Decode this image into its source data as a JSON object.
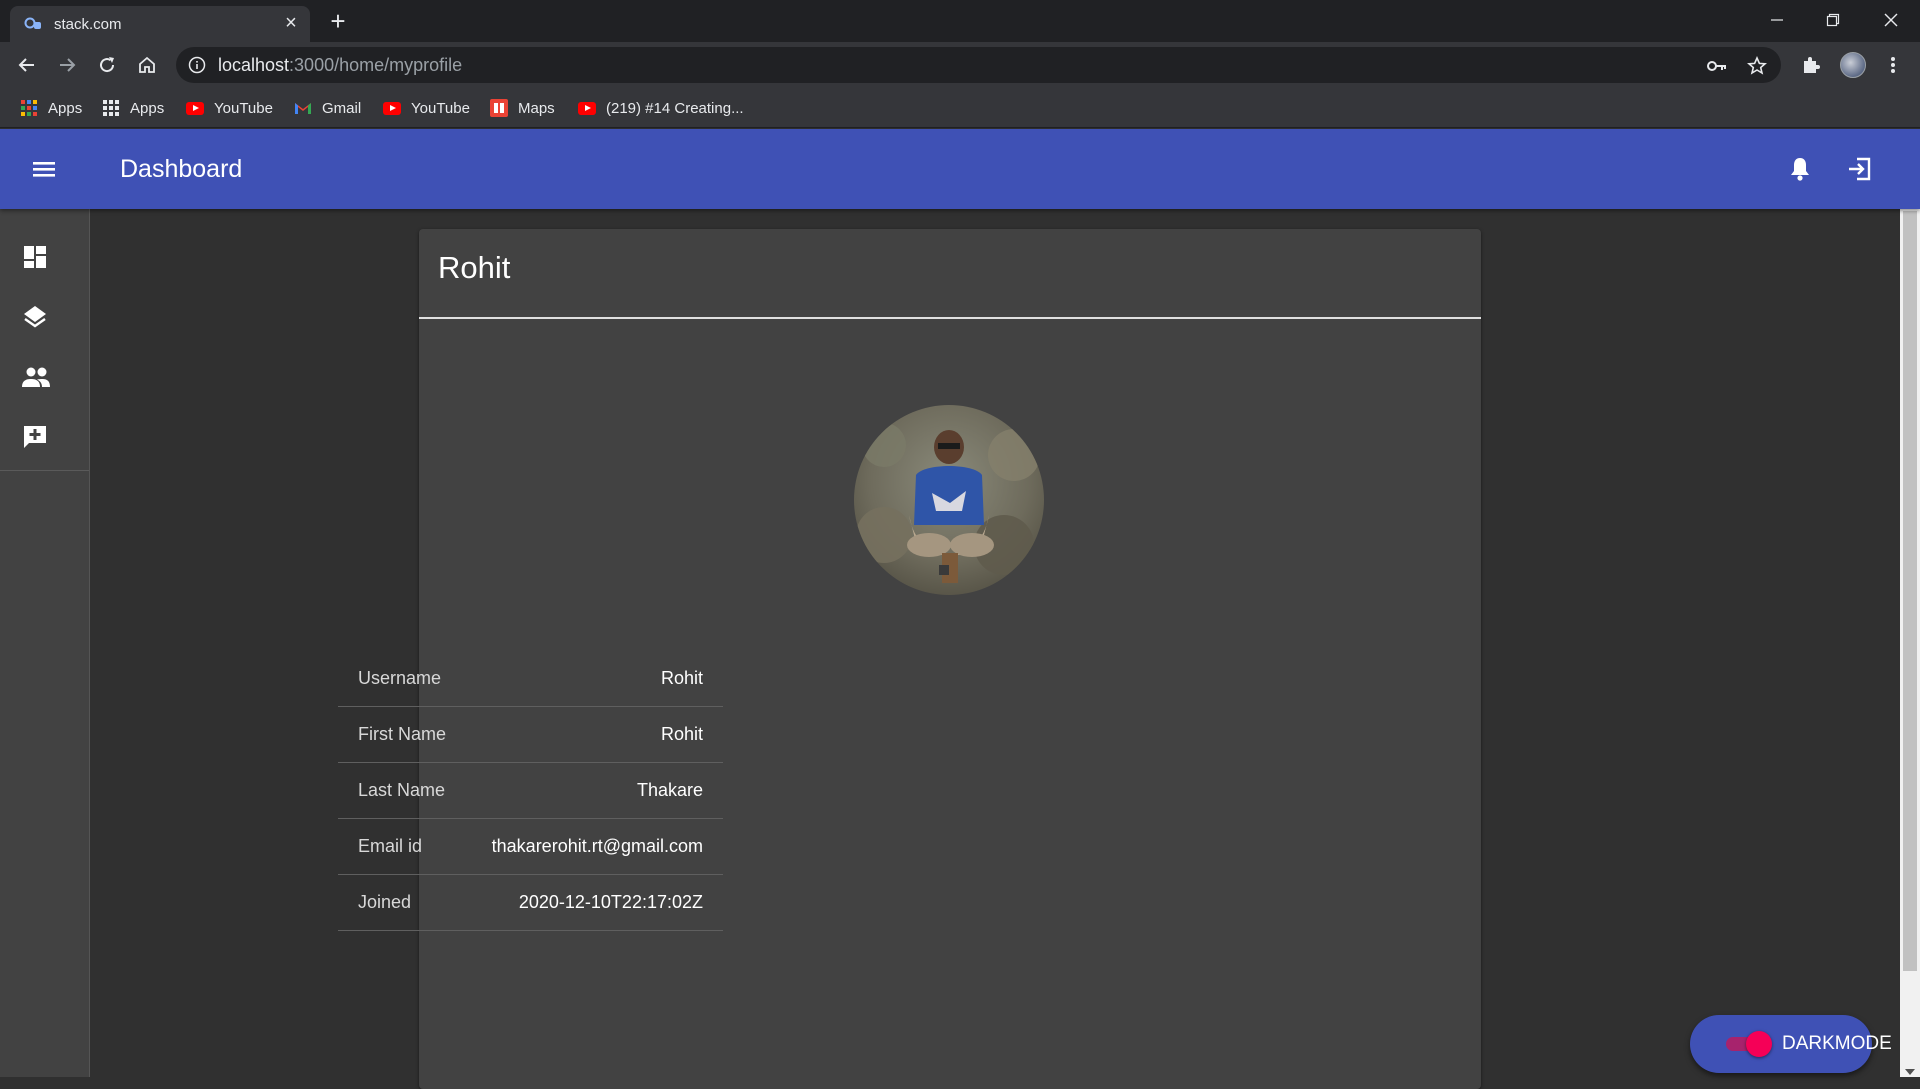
{
  "browser": {
    "tab_title": "stack.com",
    "url_host": "localhost",
    "url_path": ":3000/home/myprofile",
    "bookmarks": [
      {
        "label": "Apps",
        "icon": "apps-grid-colored-icon"
      },
      {
        "label": "Apps",
        "icon": "apps-grid-icon"
      },
      {
        "label": "YouTube",
        "icon": "youtube-icon"
      },
      {
        "label": "Gmail",
        "icon": "gmail-icon"
      },
      {
        "label": "YouTube",
        "icon": "youtube-icon"
      },
      {
        "label": "Maps",
        "icon": "maps-icon"
      },
      {
        "label": "(219) #14 Creating...",
        "icon": "youtube-icon"
      }
    ]
  },
  "appbar": {
    "title": "Dashboard",
    "color": "#3f51b5"
  },
  "sidebar": {
    "items": [
      {
        "icon": "dashboard-icon"
      },
      {
        "icon": "layers-icon"
      },
      {
        "icon": "people-icon"
      },
      {
        "icon": "add-comment-icon"
      }
    ]
  },
  "profile": {
    "card_title": "Rohit",
    "fields": [
      {
        "label": "Username",
        "value": "Rohit"
      },
      {
        "label": "First Name",
        "value": "Rohit"
      },
      {
        "label": "Last Name",
        "value": "Thakare"
      },
      {
        "label": "Email id",
        "value": "thakarerohit.rt@gmail.com"
      },
      {
        "label": "Joined",
        "value": "2020-12-10T22:17:02Z"
      }
    ]
  },
  "darkmode": {
    "label": "DARKMODE",
    "enabled": true,
    "accent": "#f50057"
  }
}
